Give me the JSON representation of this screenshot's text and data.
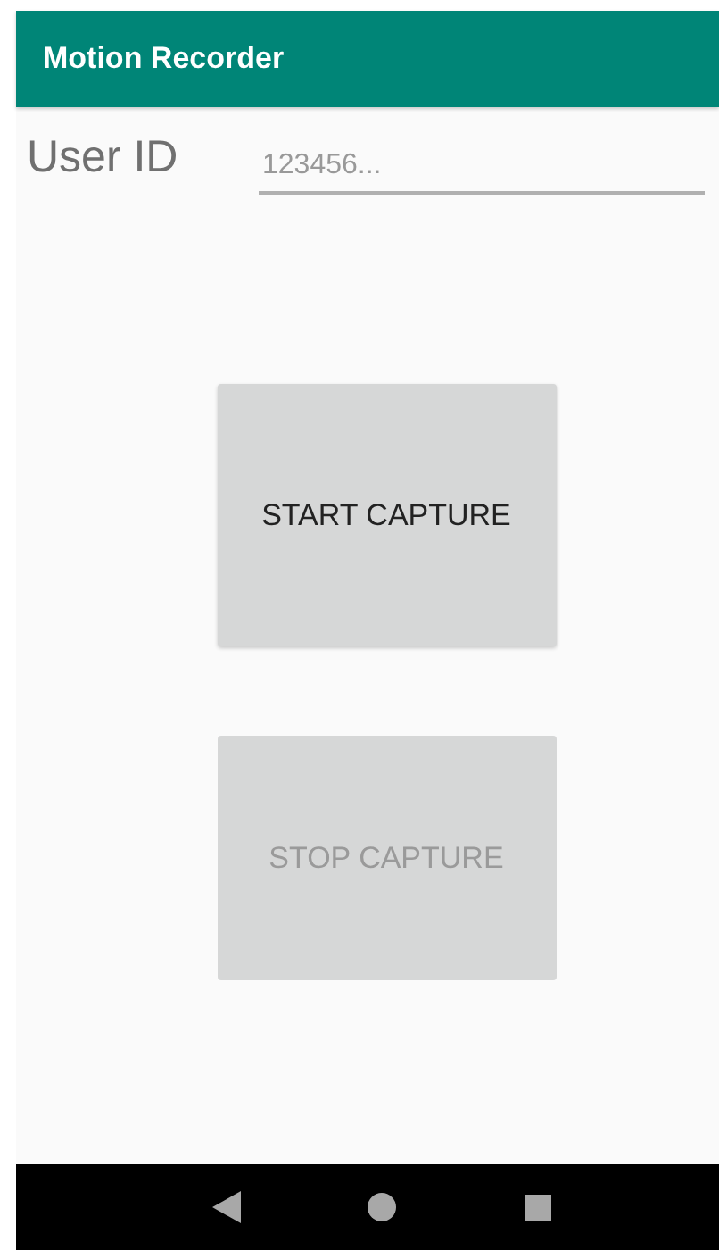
{
  "app_bar": {
    "title": "Motion Recorder"
  },
  "user_id": {
    "label": "User ID",
    "placeholder": "123456..."
  },
  "buttons": [
    {
      "label": "START CAPTURE",
      "disabled": false
    },
    {
      "label": "STOP CAPTURE",
      "disabled": true
    }
  ]
}
